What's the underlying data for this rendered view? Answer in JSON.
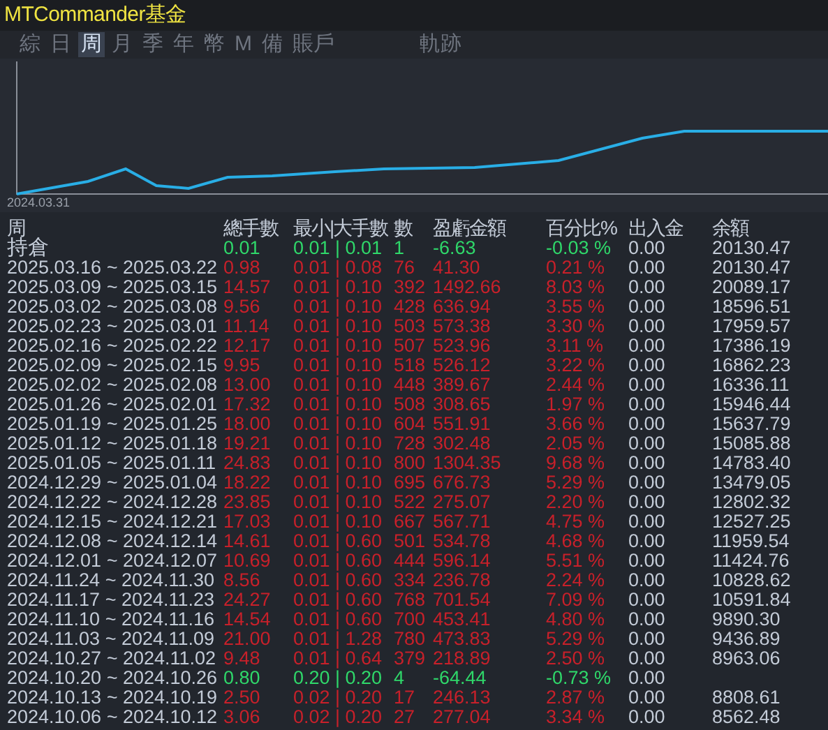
{
  "window": {
    "title": "MTCommander基金"
  },
  "tabs": [
    {
      "label": "綜",
      "selected": false
    },
    {
      "label": "日",
      "selected": false
    },
    {
      "label": "周",
      "selected": true
    },
    {
      "label": "月",
      "selected": false
    },
    {
      "label": "季",
      "selected": false
    },
    {
      "label": "年",
      "selected": false
    },
    {
      "label": "幣",
      "selected": false
    },
    {
      "label": "M",
      "selected": false
    },
    {
      "label": "備",
      "selected": false
    },
    {
      "label": "賬戶",
      "selected": false
    },
    {
      "label": "軌跡",
      "selected": false
    }
  ],
  "chart": {
    "start_label": "2024.03.31"
  },
  "table": {
    "columns": [
      "周",
      "總手數",
      "最小|大手數",
      "數",
      "盈虧金額",
      "百分比%",
      "出入金",
      "余額"
    ],
    "rows": [
      {
        "period": "持倉",
        "lots": "0.01",
        "min_max": "0.01 | 0.01",
        "count": "1",
        "profit": "-6.63",
        "percent": "-0.03 %",
        "deposit": "0.00",
        "balance": "20130.47",
        "loss": true
      },
      {
        "period": "2025.03.16 ~ 2025.03.22",
        "lots": "0.98",
        "min_max": "0.01 | 0.08",
        "count": "76",
        "profit": "41.30",
        "percent": "0.21 %",
        "deposit": "0.00",
        "balance": "20130.47",
        "loss": false
      },
      {
        "period": "2025.03.09 ~ 2025.03.15",
        "lots": "14.57",
        "min_max": "0.01 | 0.10",
        "count": "392",
        "profit": "1492.66",
        "percent": "8.03 %",
        "deposit": "0.00",
        "balance": "20089.17",
        "loss": false
      },
      {
        "period": "2025.03.02 ~ 2025.03.08",
        "lots": "9.56",
        "min_max": "0.01 | 0.10",
        "count": "428",
        "profit": "636.94",
        "percent": "3.55 %",
        "deposit": "0.00",
        "balance": "18596.51",
        "loss": false
      },
      {
        "period": "2025.02.23 ~ 2025.03.01",
        "lots": "11.14",
        "min_max": "0.01 | 0.10",
        "count": "503",
        "profit": "573.38",
        "percent": "3.30 %",
        "deposit": "0.00",
        "balance": "17959.57",
        "loss": false
      },
      {
        "period": "2025.02.16 ~ 2025.02.22",
        "lots": "12.17",
        "min_max": "0.01 | 0.10",
        "count": "507",
        "profit": "523.96",
        "percent": "3.11 %",
        "deposit": "0.00",
        "balance": "17386.19",
        "loss": false
      },
      {
        "period": "2025.02.09 ~ 2025.02.15",
        "lots": "9.95",
        "min_max": "0.01 | 0.10",
        "count": "518",
        "profit": "526.12",
        "percent": "3.22 %",
        "deposit": "0.00",
        "balance": "16862.23",
        "loss": false
      },
      {
        "period": "2025.02.02 ~ 2025.02.08",
        "lots": "13.00",
        "min_max": "0.01 | 0.10",
        "count": "448",
        "profit": "389.67",
        "percent": "2.44 %",
        "deposit": "0.00",
        "balance": "16336.11",
        "loss": false
      },
      {
        "period": "2025.01.26 ~ 2025.02.01",
        "lots": "17.32",
        "min_max": "0.01 | 0.10",
        "count": "508",
        "profit": "308.65",
        "percent": "1.97 %",
        "deposit": "0.00",
        "balance": "15946.44",
        "loss": false
      },
      {
        "period": "2025.01.19 ~ 2025.01.25",
        "lots": "18.00",
        "min_max": "0.01 | 0.10",
        "count": "604",
        "profit": "551.91",
        "percent": "3.66 %",
        "deposit": "0.00",
        "balance": "15637.79",
        "loss": false
      },
      {
        "period": "2025.01.12 ~ 2025.01.18",
        "lots": "19.21",
        "min_max": "0.01 | 0.10",
        "count": "728",
        "profit": "302.48",
        "percent": "2.05 %",
        "deposit": "0.00",
        "balance": "15085.88",
        "loss": false
      },
      {
        "period": "2025.01.05 ~ 2025.01.11",
        "lots": "24.83",
        "min_max": "0.01 | 0.10",
        "count": "800",
        "profit": "1304.35",
        "percent": "9.68 %",
        "deposit": "0.00",
        "balance": "14783.40",
        "loss": false
      },
      {
        "period": "2024.12.29 ~ 2025.01.04",
        "lots": "18.22",
        "min_max": "0.01 | 0.10",
        "count": "695",
        "profit": "676.73",
        "percent": "5.29 %",
        "deposit": "0.00",
        "balance": "13479.05",
        "loss": false
      },
      {
        "period": "2024.12.22 ~ 2024.12.28",
        "lots": "23.85",
        "min_max": "0.01 | 0.10",
        "count": "522",
        "profit": "275.07",
        "percent": "2.20 %",
        "deposit": "0.00",
        "balance": "12802.32",
        "loss": false
      },
      {
        "period": "2024.12.15 ~ 2024.12.21",
        "lots": "17.03",
        "min_max": "0.01 | 0.10",
        "count": "667",
        "profit": "567.71",
        "percent": "4.75 %",
        "deposit": "0.00",
        "balance": "12527.25",
        "loss": false
      },
      {
        "period": "2024.12.08 ~ 2024.12.14",
        "lots": "14.61",
        "min_max": "0.01 | 0.60",
        "count": "501",
        "profit": "534.78",
        "percent": "4.68 %",
        "deposit": "0.00",
        "balance": "11959.54",
        "loss": false
      },
      {
        "period": "2024.12.01 ~ 2024.12.07",
        "lots": "10.69",
        "min_max": "0.01 | 0.60",
        "count": "444",
        "profit": "596.14",
        "percent": "5.51 %",
        "deposit": "0.00",
        "balance": "11424.76",
        "loss": false
      },
      {
        "period": "2024.11.24 ~ 2024.11.30",
        "lots": "8.56",
        "min_max": "0.01 | 0.60",
        "count": "334",
        "profit": "236.78",
        "percent": "2.24 %",
        "deposit": "0.00",
        "balance": "10828.62",
        "loss": false
      },
      {
        "period": "2024.11.17 ~ 2024.11.23",
        "lots": "24.27",
        "min_max": "0.01 | 0.60",
        "count": "768",
        "profit": "701.54",
        "percent": "7.09 %",
        "deposit": "0.00",
        "balance": "10591.84",
        "loss": false
      },
      {
        "period": "2024.11.10 ~ 2024.11.16",
        "lots": "14.54",
        "min_max": "0.01 | 0.60",
        "count": "700",
        "profit": "453.41",
        "percent": "4.80 %",
        "deposit": "0.00",
        "balance": "9890.30",
        "loss": false
      },
      {
        "period": "2024.11.03 ~ 2024.11.09",
        "lots": "21.00",
        "min_max": "0.01 | 1.28",
        "count": "780",
        "profit": "473.83",
        "percent": "5.29 %",
        "deposit": "0.00",
        "balance": "9436.89",
        "loss": false
      },
      {
        "period": "2024.10.27 ~ 2024.11.02",
        "lots": "9.48",
        "min_max": "0.01 | 0.64",
        "count": "379",
        "profit": "218.89",
        "percent": "2.50 %",
        "deposit": "0.00",
        "balance": "8963.06",
        "loss": false
      },
      {
        "period": "2024.10.20 ~ 2024.10.26",
        "lots": "0.80",
        "min_max": "0.20 | 0.20",
        "count": "4",
        "profit": "-64.44",
        "percent": "-0.73 %",
        "deposit": "0.00",
        "loss": true
      },
      {
        "period": "2024.10.13 ~ 2024.10.19",
        "lots": "2.50",
        "min_max": "0.02 | 0.20",
        "count": "17",
        "profit": "246.13",
        "percent": "2.87 %",
        "deposit": "0.00",
        "balance": "8808.61",
        "loss": false
      },
      {
        "period": "2024.10.06 ~ 2024.10.12",
        "lots": "3.06",
        "min_max": "0.02 | 0.20",
        "count": "27",
        "profit": "277.04",
        "percent": "3.34 %",
        "deposit": "0.00",
        "balance": "8562.48",
        "loss": false
      }
    ]
  }
}
